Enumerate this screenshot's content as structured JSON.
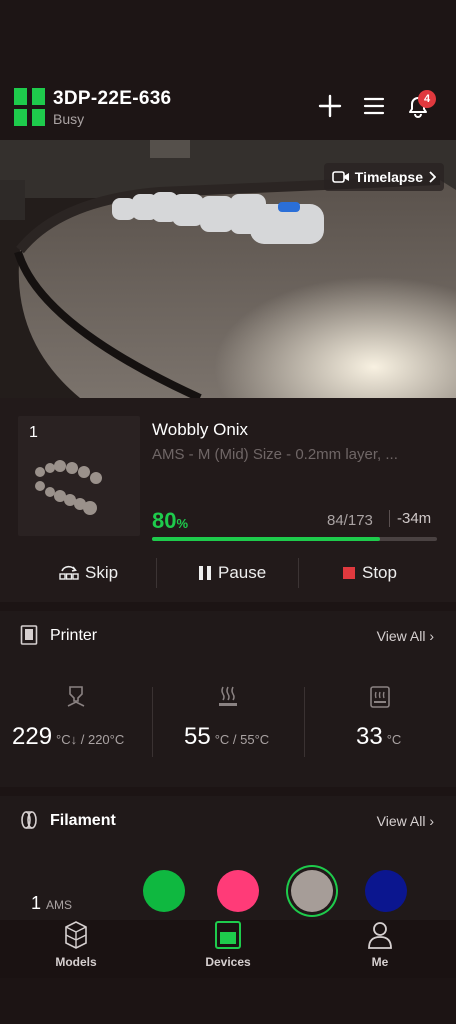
{
  "header": {
    "device_name": "3DP-22E-636",
    "status": "Busy",
    "notification_count": "4",
    "accent": "#1ecb4c"
  },
  "camera": {
    "timelapse_label": "Timelapse"
  },
  "job": {
    "plate_number": "1",
    "title": "Wobbly Onix",
    "subtitle": "AMS - M (Mid) Size - 0.2mm layer, ...",
    "progress_value": "80",
    "progress_unit": "%",
    "progress_fraction": 0.8,
    "layers": "84/173",
    "remaining": "-34m",
    "controls": {
      "skip": "Skip",
      "pause": "Pause",
      "stop": "Stop"
    }
  },
  "printer": {
    "title": "Printer",
    "view_all": "View All",
    "nozzle": {
      "current": "229",
      "detail": "°C↓ / 220°C"
    },
    "bed": {
      "current": "55",
      "detail": "°C / 55°C"
    },
    "chamber": {
      "current": "33",
      "detail": "°C"
    }
  },
  "filament": {
    "title": "Filament",
    "view_all": "View All",
    "ams_count": "1",
    "ams_unit": "AMS",
    "colors": [
      "#0fb840",
      "#ff3b78",
      "#a69d98",
      "#0b168f"
    ]
  },
  "nav": {
    "models": "Models",
    "devices": "Devices",
    "me": "Me"
  }
}
